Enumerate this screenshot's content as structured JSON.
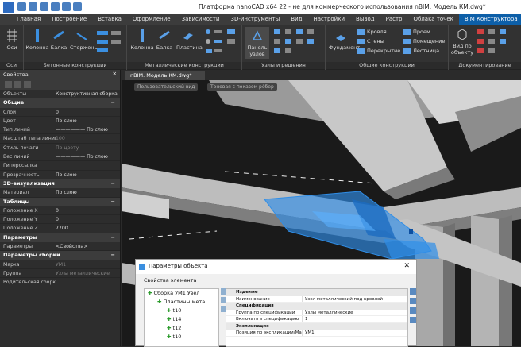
{
  "title": "Платформа nanoCAD x64 22 - не для коммерческого использования nBIM. Модель КМ.dwg*",
  "tabs": [
    "Главная",
    "Построение",
    "Вставка",
    "Оформление",
    "Зависимости",
    "3D-инструменты",
    "Вид",
    "Настройки",
    "Вывод",
    "Растр",
    "Облака точек",
    "BIM Конструктора"
  ],
  "ribbon": {
    "groups": {
      "axes": "Оси",
      "concrete": "Бетонные конструкции",
      "metal": "Металлические конструкции",
      "nodes": "Узлы и решения",
      "common": "Общие конструкции",
      "docs": "Документирование"
    },
    "buttons": {
      "axes": "Оси",
      "column": "Колонна",
      "beam": "Балка",
      "rod": "Стержень",
      "m_column": "Колонна",
      "m_beam": "Балка",
      "plate": "Пластина",
      "nodes_panel": "Панель узлов",
      "foundation": "Фундамент",
      "roof": "Кровля",
      "walls": "Стены",
      "floor": "Перекрытие",
      "opening": "Проем",
      "room": "Помещение",
      "stair": "Лестница",
      "view_by_object": "Вид по объекту"
    }
  },
  "properties": {
    "header": "Свойства",
    "object_label": "Объекты",
    "object_value": "Конструктивная сборка",
    "sections": [
      {
        "name": "Общие",
        "rows": [
          {
            "k": "Слой",
            "v": "0"
          },
          {
            "k": "Цвет",
            "v": "По слою"
          },
          {
            "k": "Тип линий",
            "v": "—————— По слою"
          },
          {
            "k": "Масштаб типа линий",
            "v": "100",
            "dim": true
          },
          {
            "k": "Стиль печати",
            "v": "По цвету",
            "dim": true
          },
          {
            "k": "Вес линий",
            "v": "—————— По слою"
          },
          {
            "k": "Гиперссылка",
            "v": ""
          },
          {
            "k": "Прозрачность",
            "v": "По слою"
          }
        ]
      },
      {
        "name": "3D-визуализация",
        "rows": [
          {
            "k": "Материал",
            "v": "По слою"
          }
        ]
      },
      {
        "name": "Таблицы",
        "rows": [
          {
            "k": "Положение X",
            "v": "0"
          },
          {
            "k": "Положение Y",
            "v": "0"
          },
          {
            "k": "Положение Z",
            "v": "7700"
          }
        ]
      },
      {
        "name": "Параметры",
        "rows": [
          {
            "k": "Параметры",
            "v": "<Свойства>"
          }
        ]
      },
      {
        "name": "Параметры сборки",
        "rows": [
          {
            "k": "Марка",
            "v": "УМ1",
            "dim": true
          },
          {
            "k": "Группа",
            "v": "Узлы металлические",
            "dim": true
          },
          {
            "k": "Родительская сборка",
            "v": ""
          }
        ]
      }
    ]
  },
  "document_tab": "nBIM. Модель КМ.dwg*",
  "viewport": {
    "view_label": "Пользовательский вид",
    "style_label": "Тоновая с показом рёбер"
  },
  "dialog": {
    "title": "Параметры объекта",
    "subtitle": "Свойства элемента",
    "tree": [
      {
        "label": "Сборка УМ1 Узел",
        "level": 0
      },
      {
        "label": "Пластины мета",
        "level": 1
      },
      {
        "label": "t10",
        "level": 2
      },
      {
        "label": "t14",
        "level": 2
      },
      {
        "label": "t12",
        "level": 2
      },
      {
        "label": "t10",
        "level": 2
      }
    ],
    "grid": [
      {
        "section": "Изделие"
      },
      {
        "k": "Наименование",
        "v": "Узел металлический под кровлей"
      },
      {
        "section": "Спецификация"
      },
      {
        "k": "Группа по спецификации",
        "v": "Узлы металлические"
      },
      {
        "k": "Включать в спецификацию",
        "v": "1"
      },
      {
        "section": "Экспликация"
      },
      {
        "k": "Позиция по экспликации/Марка",
        "v": "УМ1"
      }
    ]
  },
  "colors": {
    "accent": "#0d5fa8",
    "selection": "#2f8ee8"
  }
}
